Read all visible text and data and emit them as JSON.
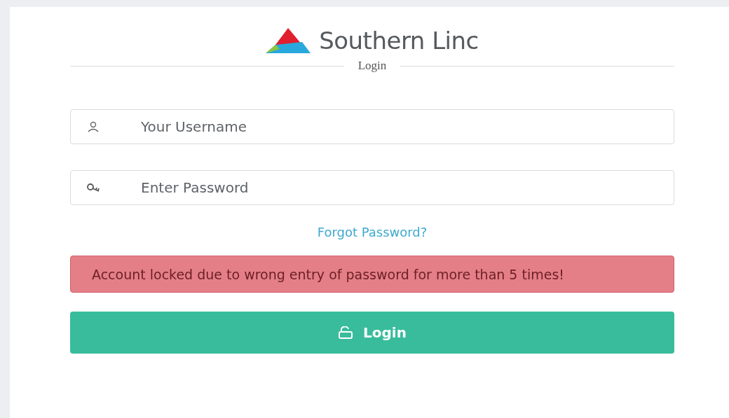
{
  "logo": {
    "name": "Southern Linc"
  },
  "heading": "Login",
  "fields": [
    {
      "kind": "user",
      "placeholder": "Your Username"
    },
    {
      "kind": "key",
      "placeholder": "Enter Password"
    }
  ],
  "forgot_link": "Forgot Password?",
  "alert": "Account locked due to wrong entry of password for more than 5 times!",
  "login_button": {
    "label": "Login"
  }
}
